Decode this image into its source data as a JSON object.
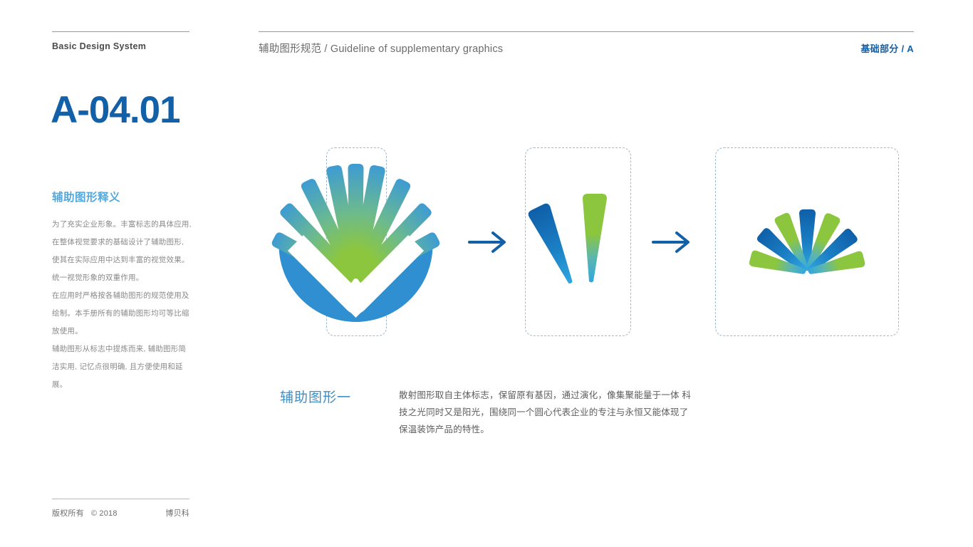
{
  "left_column": {
    "label": "Basic Design System",
    "page_code": "A-04.01",
    "section_heading": "辅助图形释义",
    "body_paragraphs": [
      "为了充实企业形象。丰富标志的具体应用, 在整体视觉要求的基础设计了辅助图形, 使其在实际应用中达到丰富的视觉效果。统一视觉形象的双重作用。",
      "在应用时严格按各辅助图形的规范使用及绘制。本手册所有的辅助图形均可等比缩放使用。",
      "辅助图形从标志中提炼而来, 辅助图形简洁实用, 记忆点很明确, 且方便使用和延展。"
    ]
  },
  "header": {
    "title": "辅助图形规范 / Guideline of supplementary graphics",
    "section": "基础部分 / A"
  },
  "graphics": {
    "step_1_name": "full-logo-shell-mark",
    "step_2_name": "two-petal-extraction",
    "step_3_name": "radiating-fan-graphic",
    "arrow_1_name": "process-arrow-right",
    "arrow_2_name": "process-arrow-right"
  },
  "caption": {
    "label": "辅助图形一",
    "body": "散射图形取自主体标志，保留原有基因，通过演化，像集聚能量于一体  科技之光同时又是阳光，围绕同一个圆心代表企业的专注与永恒又能体现了保温装饰产品的特性。"
  },
  "footer": {
    "rights": "版权所有",
    "copyright": "© 2018",
    "brand": "博贝科"
  },
  "colors": {
    "accent_blue": "#1160a8",
    "light_blue": "#53a8dd",
    "logo_blue": "#2f8fd0",
    "logo_green": "#8cc63f",
    "deep_blue": "#0f5fa8",
    "dash_border": "#9fb9cf",
    "body_gray": "#8a8a8a"
  }
}
